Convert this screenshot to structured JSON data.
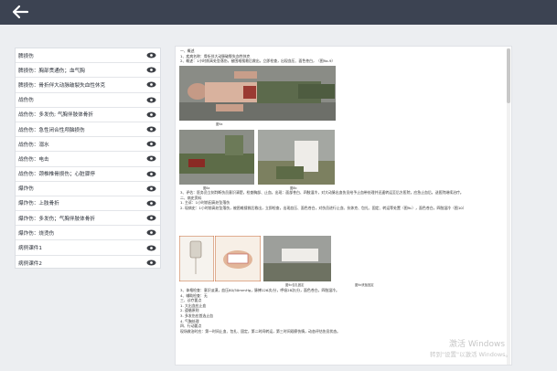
{
  "sidebar": {
    "items": [
      {
        "label": "脾损伤"
      },
      {
        "label": "脾损伤：胸部贯通伤；血气胸"
      },
      {
        "label": "脾损伤：骨折伴大动脉破裂失血性休克"
      },
      {
        "label": "战伤伤"
      },
      {
        "label": "战伤伤：多发伤; 气胸伴肢体骨折"
      },
      {
        "label": "战伤伤：急性闭合性颅脑损伤"
      },
      {
        "label": "战伤伤：溺水"
      },
      {
        "label": "战伤伤：电击"
      },
      {
        "label": "战伤伤：颈椎椎骨损伤；心脏骤停"
      },
      {
        "label": "爆炸伤"
      },
      {
        "label": "爆炸伤：上肢骨折"
      },
      {
        "label": "爆炸伤：多发伤；气胸伴肢体骨折"
      },
      {
        "label": "爆炸伤：烧烫伤"
      },
      {
        "label": "病例课件1"
      },
      {
        "label": "病例课件2"
      }
    ]
  },
  "doc": {
    "lines": [
      "一、概述",
      "1、疾病名称：骨折伴大动脉破裂失血性休克",
      "2、概述：1小时前高处坠落伤，被困难搜救后救出，立即检查，出现血压、面色苍白，（图9a-9）"
    ],
    "caption_top": "图9a",
    "caption_mid_left": "图8a",
    "caption_mid_right": "图8b",
    "block2": [
      "3、评估：医务员立刻判断伤员意识清楚，检查胸部、止血，出现：面部苍白、四肢湿冷，对大动脉出血伤员给予止血带处理并迅速转运至后方医院，应急止血后，送医院继续治疗。",
      "二、病史资料",
      "1. 主诉：1小时前因高处坠落伤",
      "2. 现病史：1小时前高处坠落伤，被困难搜救后救出，立即检查，出现血压、面色苍白，对伤员进行止血、抗休克、包扎、固定、转运等处置（图9c），面色苍白，四肢湿冷（图10）"
    ],
    "caption_bottom_a": "图9c包扎固定",
    "caption_bottom_b": "图9d夹板固定",
    "block3": [
      "3、体格检查：意识淡漠，血压80/50mmHg，脉搏126次/分，呼吸28次/分，面色苍白，四肢湿冷。",
      "4、辅助检查：无",
      "三、诊疗要点",
      "1. 大出血应止血",
      "2. 遵循原则",
      "3. 多发伤应首选止血",
      "4. 气胸处理",
      "四、行动要点",
      "现场救治时应：第一时间止血、包扎、固定，第二时间转运，第三时间观察伤情，动态评估伤员状态。"
    ]
  },
  "watermark": {
    "line1": "激活 Windows",
    "line2": "转到\"设置\"以激活 Windows。"
  },
  "colors": {
    "topbar": "#3c4352",
    "page_bg": "#eceef1"
  },
  "icons": {
    "back": "arrow-left-icon",
    "item": "eye-icon"
  }
}
